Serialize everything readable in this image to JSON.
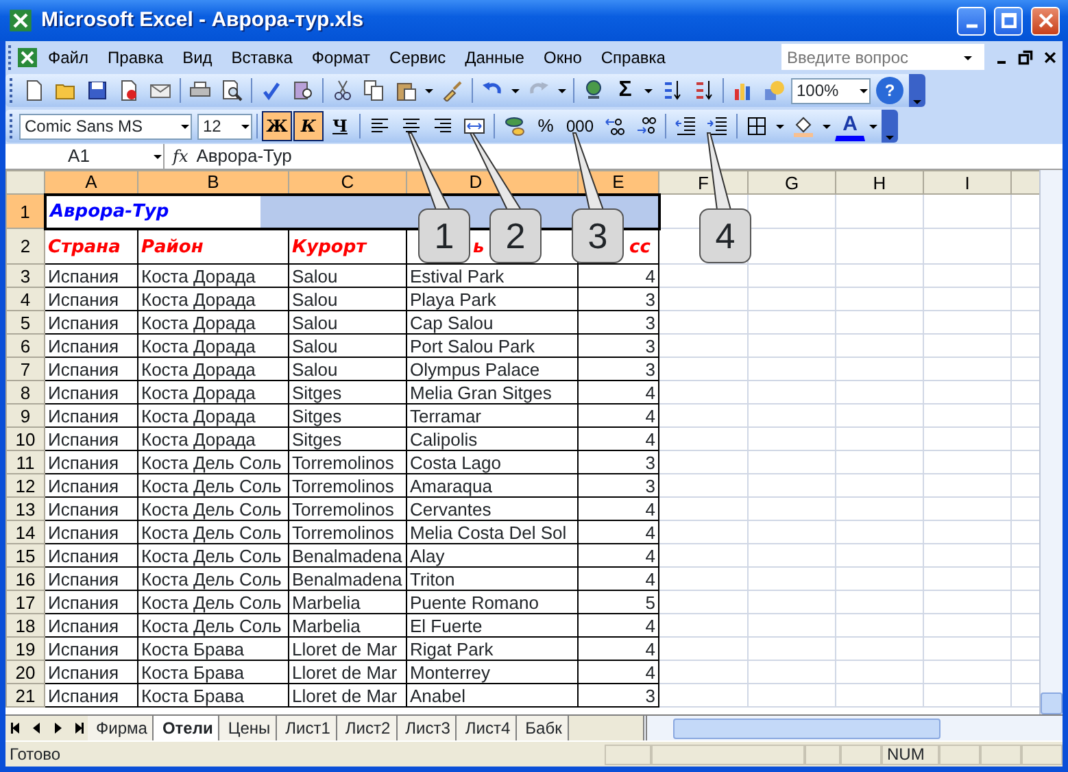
{
  "window": {
    "title": "Microsoft Excel - Аврора-тур.xls"
  },
  "menu": [
    "Файл",
    "Правка",
    "Вид",
    "Вставка",
    "Формат",
    "Сервис",
    "Данные",
    "Окно",
    "Справка"
  ],
  "help_search": {
    "placeholder": "Введите вопрос"
  },
  "standard_toolbar": {
    "sum": "Σ",
    "zoom": "100%",
    "help": "?"
  },
  "formatting_toolbar": {
    "font": "Comic Sans MS",
    "size": "12",
    "buttons": [
      {
        "label": "Ж",
        "kind": "bold",
        "on": true
      },
      {
        "label": "К",
        "kind": "italic",
        "on": true
      },
      {
        "label": "Ч",
        "kind": "underline",
        "on": false
      }
    ],
    "percent": "%",
    "thousands": "000",
    "font_color": "A"
  },
  "formula_bar": {
    "name_box": "A1",
    "fx": "fx",
    "value": "Аврора-Тур"
  },
  "sheet": {
    "columns": [
      {
        "label": "A",
        "selected": true
      },
      {
        "label": "B",
        "selected": true
      },
      {
        "label": "C",
        "selected": true
      },
      {
        "label": "D",
        "selected": true
      },
      {
        "label": "E",
        "selected": true
      },
      {
        "label": "F",
        "selected": false
      },
      {
        "label": "G",
        "selected": false
      },
      {
        "label": "H",
        "selected": false
      },
      {
        "label": "I",
        "selected": false
      }
    ],
    "title_row": {
      "number": "1",
      "text": "Аврора-Тур",
      "selected": true
    },
    "header_row": {
      "number": "2",
      "cells": [
        "Страна",
        "Район",
        "Курорт",
        "ь",
        "сс"
      ]
    },
    "rows": [
      {
        "number": "3",
        "cells": [
          "Испания",
          "Коста Дорада",
          "Salou",
          "Estival Park",
          "4"
        ]
      },
      {
        "number": "4",
        "cells": [
          "Испания",
          "Коста Дорада",
          "Salou",
          "Playa Park",
          "3"
        ]
      },
      {
        "number": "5",
        "cells": [
          "Испания",
          "Коста Дорада",
          "Salou",
          "Cap Salou",
          "3"
        ]
      },
      {
        "number": "6",
        "cells": [
          "Испания",
          "Коста Дорада",
          "Salou",
          "Port Salou Park",
          "3"
        ]
      },
      {
        "number": "7",
        "cells": [
          "Испания",
          "Коста Дорада",
          "Salou",
          "Olympus Palace",
          "3"
        ]
      },
      {
        "number": "8",
        "cells": [
          "Испания",
          "Коста Дорада",
          "Sitges",
          "Melia Gran Sitges",
          "4"
        ]
      },
      {
        "number": "9",
        "cells": [
          "Испания",
          "Коста Дорада",
          "Sitges",
          "Terramar",
          "4"
        ]
      },
      {
        "number": "10",
        "cells": [
          "Испания",
          "Коста Дорада",
          "Sitges",
          "Calipolis",
          "4"
        ]
      },
      {
        "number": "11",
        "cells": [
          "Испания",
          "Коста Дель Соль",
          "Torremolinos",
          "Costa Lago",
          "3"
        ]
      },
      {
        "number": "12",
        "cells": [
          "Испания",
          "Коста Дель Соль",
          "Torremolinos",
          "Amaraqua",
          "3"
        ]
      },
      {
        "number": "13",
        "cells": [
          "Испания",
          "Коста Дель Соль",
          "Torremolinos",
          "Cervantes",
          "4"
        ]
      },
      {
        "number": "14",
        "cells": [
          "Испания",
          "Коста Дель Соль",
          "Torremolinos",
          "Melia Costa Del Sol",
          "4"
        ]
      },
      {
        "number": "15",
        "cells": [
          "Испания",
          "Коста Дель Соль",
          "Benalmadena",
          "Alay",
          "4"
        ]
      },
      {
        "number": "16",
        "cells": [
          "Испания",
          "Коста Дель Соль",
          "Benalmadena",
          "Triton",
          "4"
        ]
      },
      {
        "number": "17",
        "cells": [
          "Испания",
          "Коста Дель Соль",
          "Marbelia",
          "Puente Romano",
          "5"
        ]
      },
      {
        "number": "18",
        "cells": [
          "Испания",
          "Коста Дель Соль",
          "Marbelia",
          "El Fuerte",
          "4"
        ]
      },
      {
        "number": "19",
        "cells": [
          "Испания",
          "Коста Брава",
          "Lloret de Mar",
          "Rigat Park",
          "4"
        ]
      },
      {
        "number": "20",
        "cells": [
          "Испания",
          "Коста Брава",
          "Lloret de Mar",
          "Monterrey",
          "4"
        ]
      },
      {
        "number": "21",
        "cells": [
          "Испания",
          "Коста Брава",
          "Lloret de Mar",
          "Anabel",
          "3"
        ]
      }
    ]
  },
  "callouts": [
    "1",
    "2",
    "3",
    "4"
  ],
  "sheet_tabs": [
    {
      "label": "Фирма",
      "selected": false
    },
    {
      "label": "Отели",
      "selected": true
    },
    {
      "label": "Цены",
      "selected": false
    },
    {
      "label": "Лист1",
      "selected": false
    },
    {
      "label": "Лист2",
      "selected": false
    },
    {
      "label": "Лист3",
      "selected": false
    },
    {
      "label": "Лист4",
      "selected": false
    },
    {
      "label": "Бабк",
      "selected": false
    }
  ],
  "status_bar": {
    "text": "Готово",
    "indicator": "NUM"
  }
}
